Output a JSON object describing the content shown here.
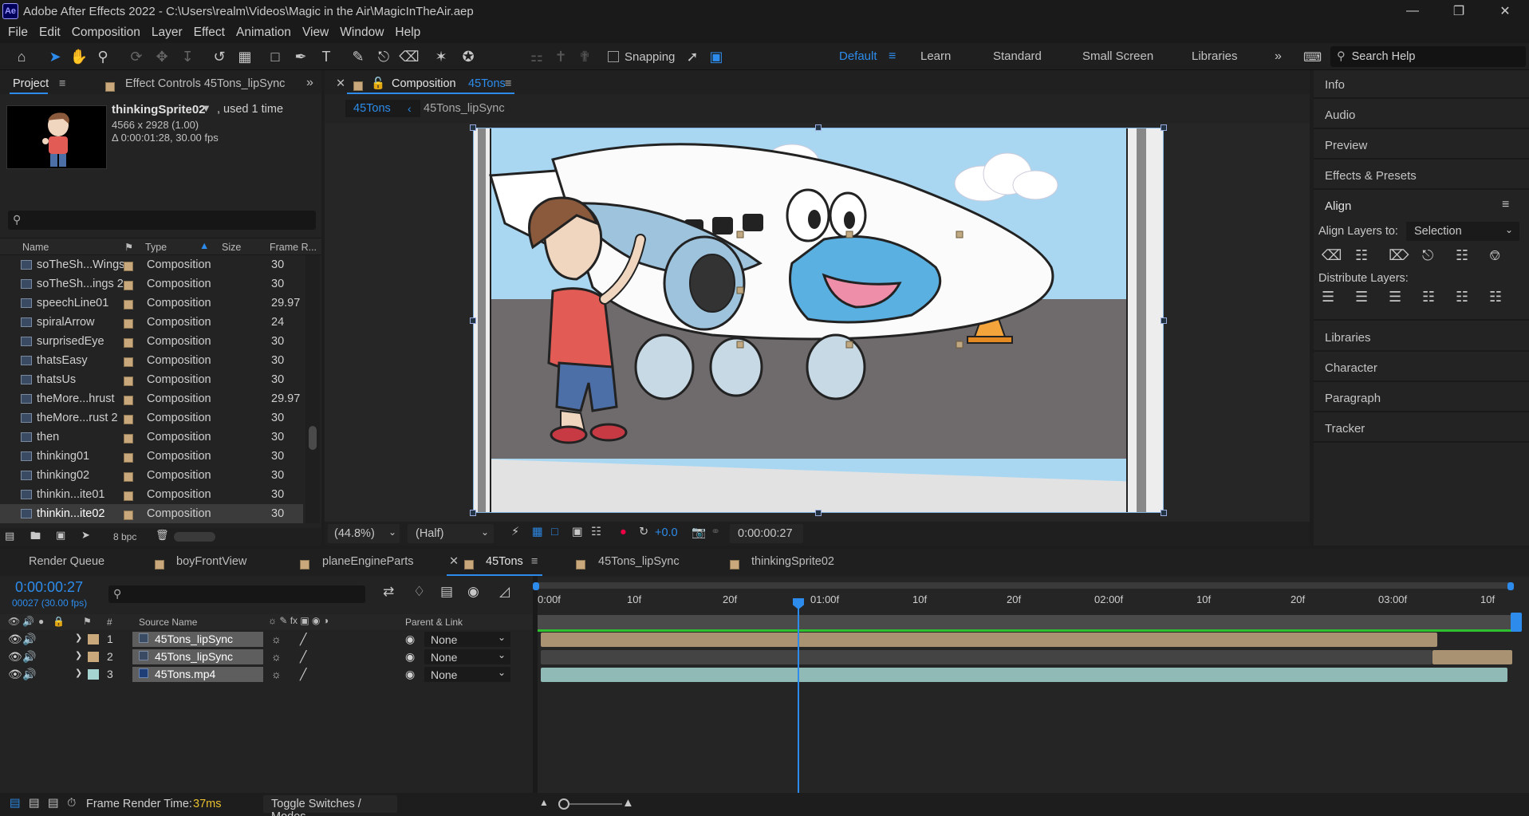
{
  "window": {
    "app_icon": "Ae",
    "title": "Adobe After Effects 2022 - C:\\Users\\realm\\Videos\\Magic in the Air\\MagicInTheAir.aep"
  },
  "menu": [
    "File",
    "Edit",
    "Composition",
    "Layer",
    "Effect",
    "Animation",
    "View",
    "Window",
    "Help"
  ],
  "toolbar": {
    "snapping_label": "Snapping",
    "workspaces": [
      "Default",
      "Learn",
      "Standard",
      "Small Screen",
      "Libraries"
    ],
    "active_workspace": "Default",
    "search_placeholder": "Search Help"
  },
  "project": {
    "tab_label": "Project",
    "effect_controls_label": "Effect Controls 45Tons_lipSync",
    "selected_name": "thinkingSprite02",
    "used_label": ", used 1 time",
    "dims": "4566 x 2928 (1.00)",
    "duration": "Δ 0:00:01:28, 30.00 fps",
    "search_placeholder": "",
    "columns": {
      "name": "Name",
      "type": "Type",
      "size": "Size",
      "frame_rate": "Frame R..."
    },
    "items": [
      {
        "name": "soTheSh...Wings",
        "type": "Composition",
        "fps": "30"
      },
      {
        "name": "soTheSh...ings 2",
        "type": "Composition",
        "fps": "30"
      },
      {
        "name": "speechLine01",
        "type": "Composition",
        "fps": "29.97"
      },
      {
        "name": "spiralArrow",
        "type": "Composition",
        "fps": "24"
      },
      {
        "name": "surprisedEye",
        "type": "Composition",
        "fps": "30"
      },
      {
        "name": "thatsEasy",
        "type": "Composition",
        "fps": "30"
      },
      {
        "name": "thatsUs",
        "type": "Composition",
        "fps": "30"
      },
      {
        "name": "theMore...hrust",
        "type": "Composition",
        "fps": "29.97"
      },
      {
        "name": "theMore...rust 2",
        "type": "Composition",
        "fps": "30"
      },
      {
        "name": "then",
        "type": "Composition",
        "fps": "30"
      },
      {
        "name": "thinking01",
        "type": "Composition",
        "fps": "30"
      },
      {
        "name": "thinking02",
        "type": "Composition",
        "fps": "30"
      },
      {
        "name": "thinkin...ite01",
        "type": "Composition",
        "fps": "30"
      },
      {
        "name": "thinkin...ite02",
        "type": "Composition",
        "fps": "30",
        "selected": true
      }
    ],
    "bpc": "8 bpc"
  },
  "viewer": {
    "tab_label": "Composition",
    "tab_comp": "45Tons",
    "breadcrumb": [
      "45Tons",
      "45Tons_lipSync"
    ],
    "zoom": "(44.8%)",
    "resolution": "(Half)",
    "exposure": "+0.0",
    "timecode": "0:00:00:27"
  },
  "right_panel": {
    "sections": [
      "Info",
      "Audio",
      "Preview",
      "Effects & Presets"
    ],
    "align_title": "Align",
    "align_layers_to": "Align Layers to:",
    "align_target": "Selection",
    "distribute_label": "Distribute Layers:",
    "sections_after": [
      "Libraries",
      "Character",
      "Paragraph",
      "Tracker"
    ]
  },
  "timeline": {
    "tabs": [
      "Render Queue",
      "boyFrontView",
      "planeEngineParts",
      "45Tons",
      "45Tons_lipSync",
      "thinkingSprite02"
    ],
    "active_tab": "45Tons",
    "timecode": "0:00:00:27",
    "frame_info": "00027 (30.00 fps)",
    "col_hash": "#",
    "col_source": "Source Name",
    "col_parent": "Parent & Link",
    "ruler": [
      "0:00f",
      "10f",
      "20f",
      "01:00f",
      "10f",
      "20f",
      "02:00f",
      "10f",
      "20f",
      "03:00f",
      "10f"
    ],
    "playhead_frame": 27,
    "layers": [
      {
        "num": "1",
        "name": "45Tons_lipSync",
        "parent": "None",
        "color": "#c9a97b"
      },
      {
        "num": "2",
        "name": "45Tons_lipSync",
        "parent": "None",
        "color": "#c9a97b"
      },
      {
        "num": "3",
        "name": "45Tons.mp4",
        "parent": "None",
        "color": "#a6d4d0"
      }
    ]
  },
  "status": {
    "frame_render_label": "Frame Render Time:",
    "frame_render_value": "37ms",
    "toggle": "Toggle Switches / Modes"
  }
}
